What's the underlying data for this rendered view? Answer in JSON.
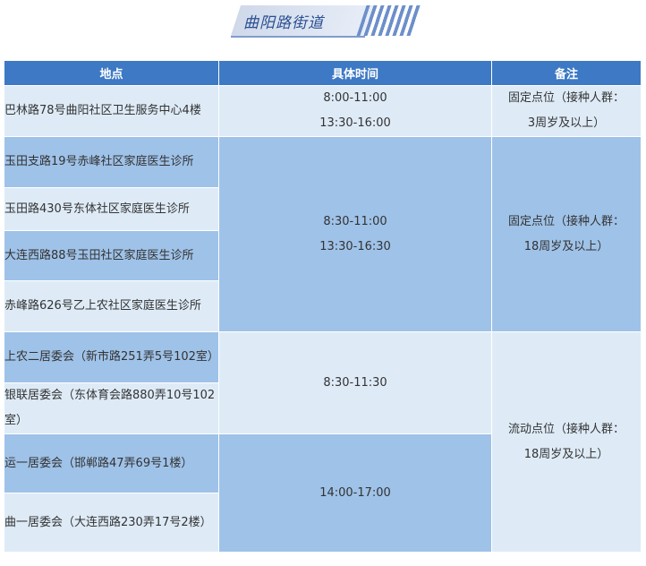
{
  "title": "曲阳路街道",
  "headers": {
    "location": "地点",
    "time": "具体时间",
    "note": "备注"
  },
  "rows": [
    {
      "location": "巴林路78号曲阳社区卫生服务中心4楼"
    },
    {
      "location": "玉田支路19号赤峰社区家庭医生诊所"
    },
    {
      "location": "玉田路430号东体社区家庭医生诊所"
    },
    {
      "location": "大连西路88号玉田社区家庭医生诊所"
    },
    {
      "location": "赤峰路626号乙上农社区家庭医生诊所"
    },
    {
      "location": "上农二居委会（新市路251弄5号102室）"
    },
    {
      "location": "银联居委会（东体育会路880弄10号102室）"
    },
    {
      "location": "运一居委会（邯郸路47弄69号1楼）"
    },
    {
      "location": "曲一居委会（大连西路230弄17号2楼）"
    }
  ],
  "times": [
    {
      "line1": "8:00-11:00",
      "line2": "13:30-16:00"
    },
    {
      "line1": "8:30-11:00",
      "line2": "13:30-16:30"
    },
    {
      "line1": "8:30-11:30",
      "line2": ""
    },
    {
      "line1": "14:00-17:00",
      "line2": ""
    }
  ],
  "notes": [
    {
      "line1": "固定点位（接种人群：",
      "line2": "3周岁及以上）"
    },
    {
      "line1": "固定点位（接种人群：",
      "line2": "18周岁及以上）"
    },
    {
      "line1": "流动点位（接种人群：",
      "line2": "18周岁及以上）"
    }
  ]
}
